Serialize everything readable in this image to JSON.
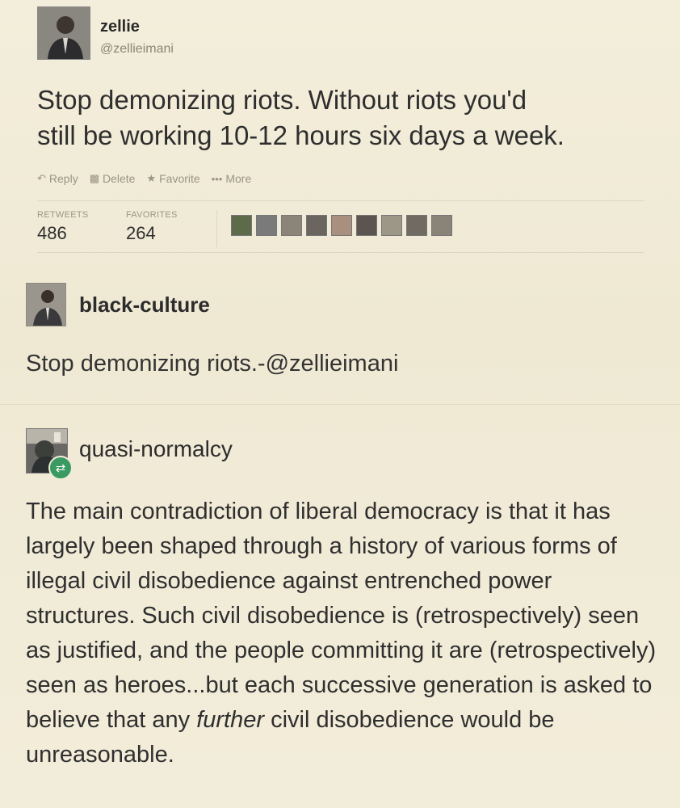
{
  "tweet": {
    "name": "zellie",
    "handle": "@zellieimani",
    "text_line1": "Stop demonizing riots. Without riots you'd",
    "text_line2": "still be working 10-12 hours six days a week.",
    "actions": {
      "reply": "Reply",
      "delete": "Delete",
      "favorite": "Favorite",
      "more": "More"
    },
    "stats": {
      "retweets_label": "RETWEETS",
      "retweets": "486",
      "favorites_label": "FAVORITES",
      "favorites": "264"
    },
    "favoriter_colors": [
      "#5d6b4a",
      "#7a7a7a",
      "#8c8478",
      "#6b6560",
      "#a88f7e",
      "#5a5550",
      "#9d9787",
      "#6f6a62",
      "#8a8377"
    ]
  },
  "reblog1": {
    "user": "black-culture",
    "text": "Stop demonizing riots.-@zellieimani"
  },
  "reblog2": {
    "user": "quasi-normalcy",
    "badge_icon": "reblog-icon",
    "text_before": "The main contradiction of liberal democracy is that it has largely been shaped through a history of various forms of illegal civil disobedience against entrenched power structures. Such civil disobedience is (retrospectively) seen as justified, and the people committing it are (retrospectively) seen as heroes...but each successive generation is asked to believe that any ",
    "text_em": "further",
    "text_after": " civil disobedience would be unreasonable."
  },
  "colors": {
    "background": "#f1ecd9",
    "reblog_green": "#3b9a62",
    "muted": "#9a9482"
  }
}
